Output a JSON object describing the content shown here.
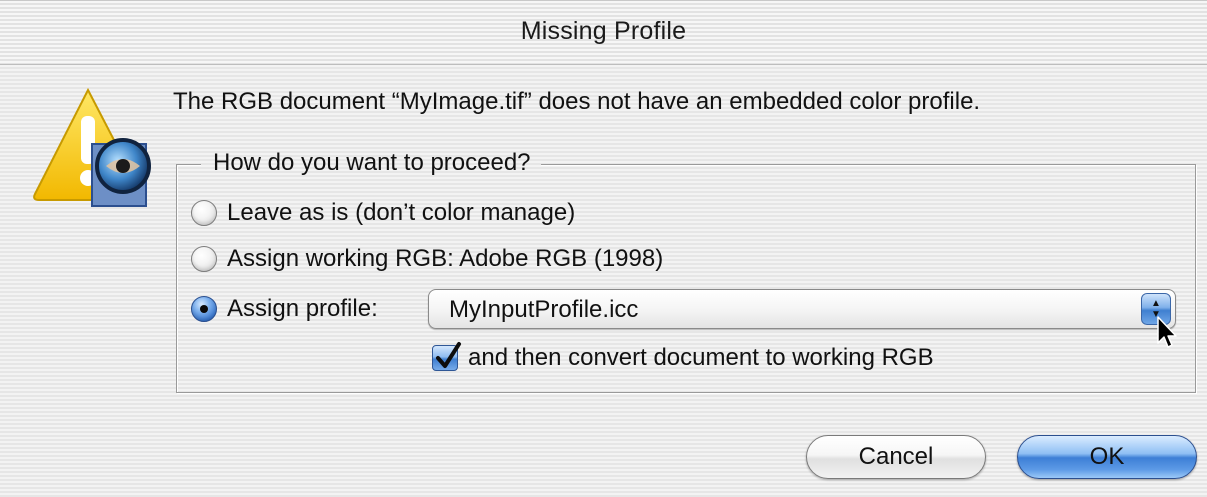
{
  "window": {
    "title": "Missing Profile"
  },
  "icon": {
    "name": "warning-icon",
    "accent": "#f7c600"
  },
  "message": "The RGB document “MyImage.tif” does not have an embedded color profile.",
  "group": {
    "legend": "How do you want to proceed?",
    "options": [
      {
        "label": "Leave as is (don’t color manage)",
        "selected": false
      },
      {
        "label": "Assign working RGB:  Adobe RGB (1998)",
        "selected": false
      },
      {
        "label": "Assign profile:",
        "selected": true
      }
    ],
    "profile_popup": {
      "value": "MyInputProfile.icc"
    },
    "convert_checkbox": {
      "label": "and then convert document to working RGB",
      "checked": true
    }
  },
  "buttons": {
    "cancel": "Cancel",
    "ok": "OK"
  },
  "colors": {
    "aqua_blue": "#3d7fd6",
    "warning_yellow": "#f7c600"
  }
}
